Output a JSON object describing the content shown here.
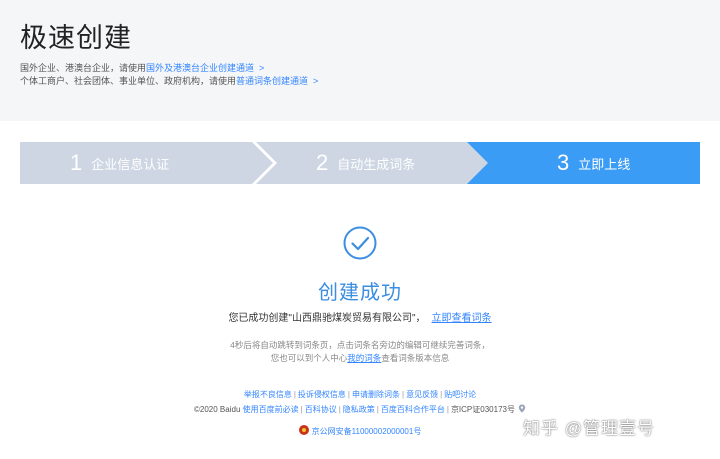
{
  "header": {
    "title": "极速创建",
    "hint1": {
      "prefix": "国外企业、港澳台企业，请使用",
      "link": "国外及港澳台企业创建通道",
      "arrow": ">"
    },
    "hint2": {
      "prefix": "个体工商户、社会团体、事业单位、政府机构，请使用",
      "link": "普通词条创建通道",
      "arrow": ">"
    }
  },
  "steps": [
    {
      "num": "1",
      "label": "企业信息认证",
      "state": "done"
    },
    {
      "num": "2",
      "label": "自动生成词条",
      "state": "done"
    },
    {
      "num": "3",
      "label": "立即上线",
      "state": "active"
    }
  ],
  "colors": {
    "step_inactive": "#cdd6e2",
    "step_active": "#3b9cf5",
    "accent": "#3b8ee0",
    "link": "#3385ff"
  },
  "success": {
    "icon": "check-circle-icon",
    "title": "创建成功",
    "message": "您已成功创建\"山西鼎驰煤炭贸易有限公司\"，",
    "view_link": "立即查看词条"
  },
  "redirect": {
    "line1": "4秒后将自动跳转到词条页，点击词条名旁边的编辑可继续完善词条，",
    "line2_prefix": "您也可以到个人中心",
    "line2_link": "我的词条",
    "line2_suffix": "查看词条版本信息"
  },
  "footer": {
    "links": [
      "举报不良信息",
      "投诉侵权信息",
      "申请删除词条",
      "意见反馈",
      "贴吧讨论"
    ],
    "copyright": "©2020 Baidu",
    "copy_links": [
      "使用百度前必读",
      "百科协议",
      "隐私政策",
      "百度百科合作平台"
    ],
    "icp": "京ICP证030173号",
    "police": "京公网安备11000002000001号"
  },
  "watermark": "知乎 @管理壹号"
}
